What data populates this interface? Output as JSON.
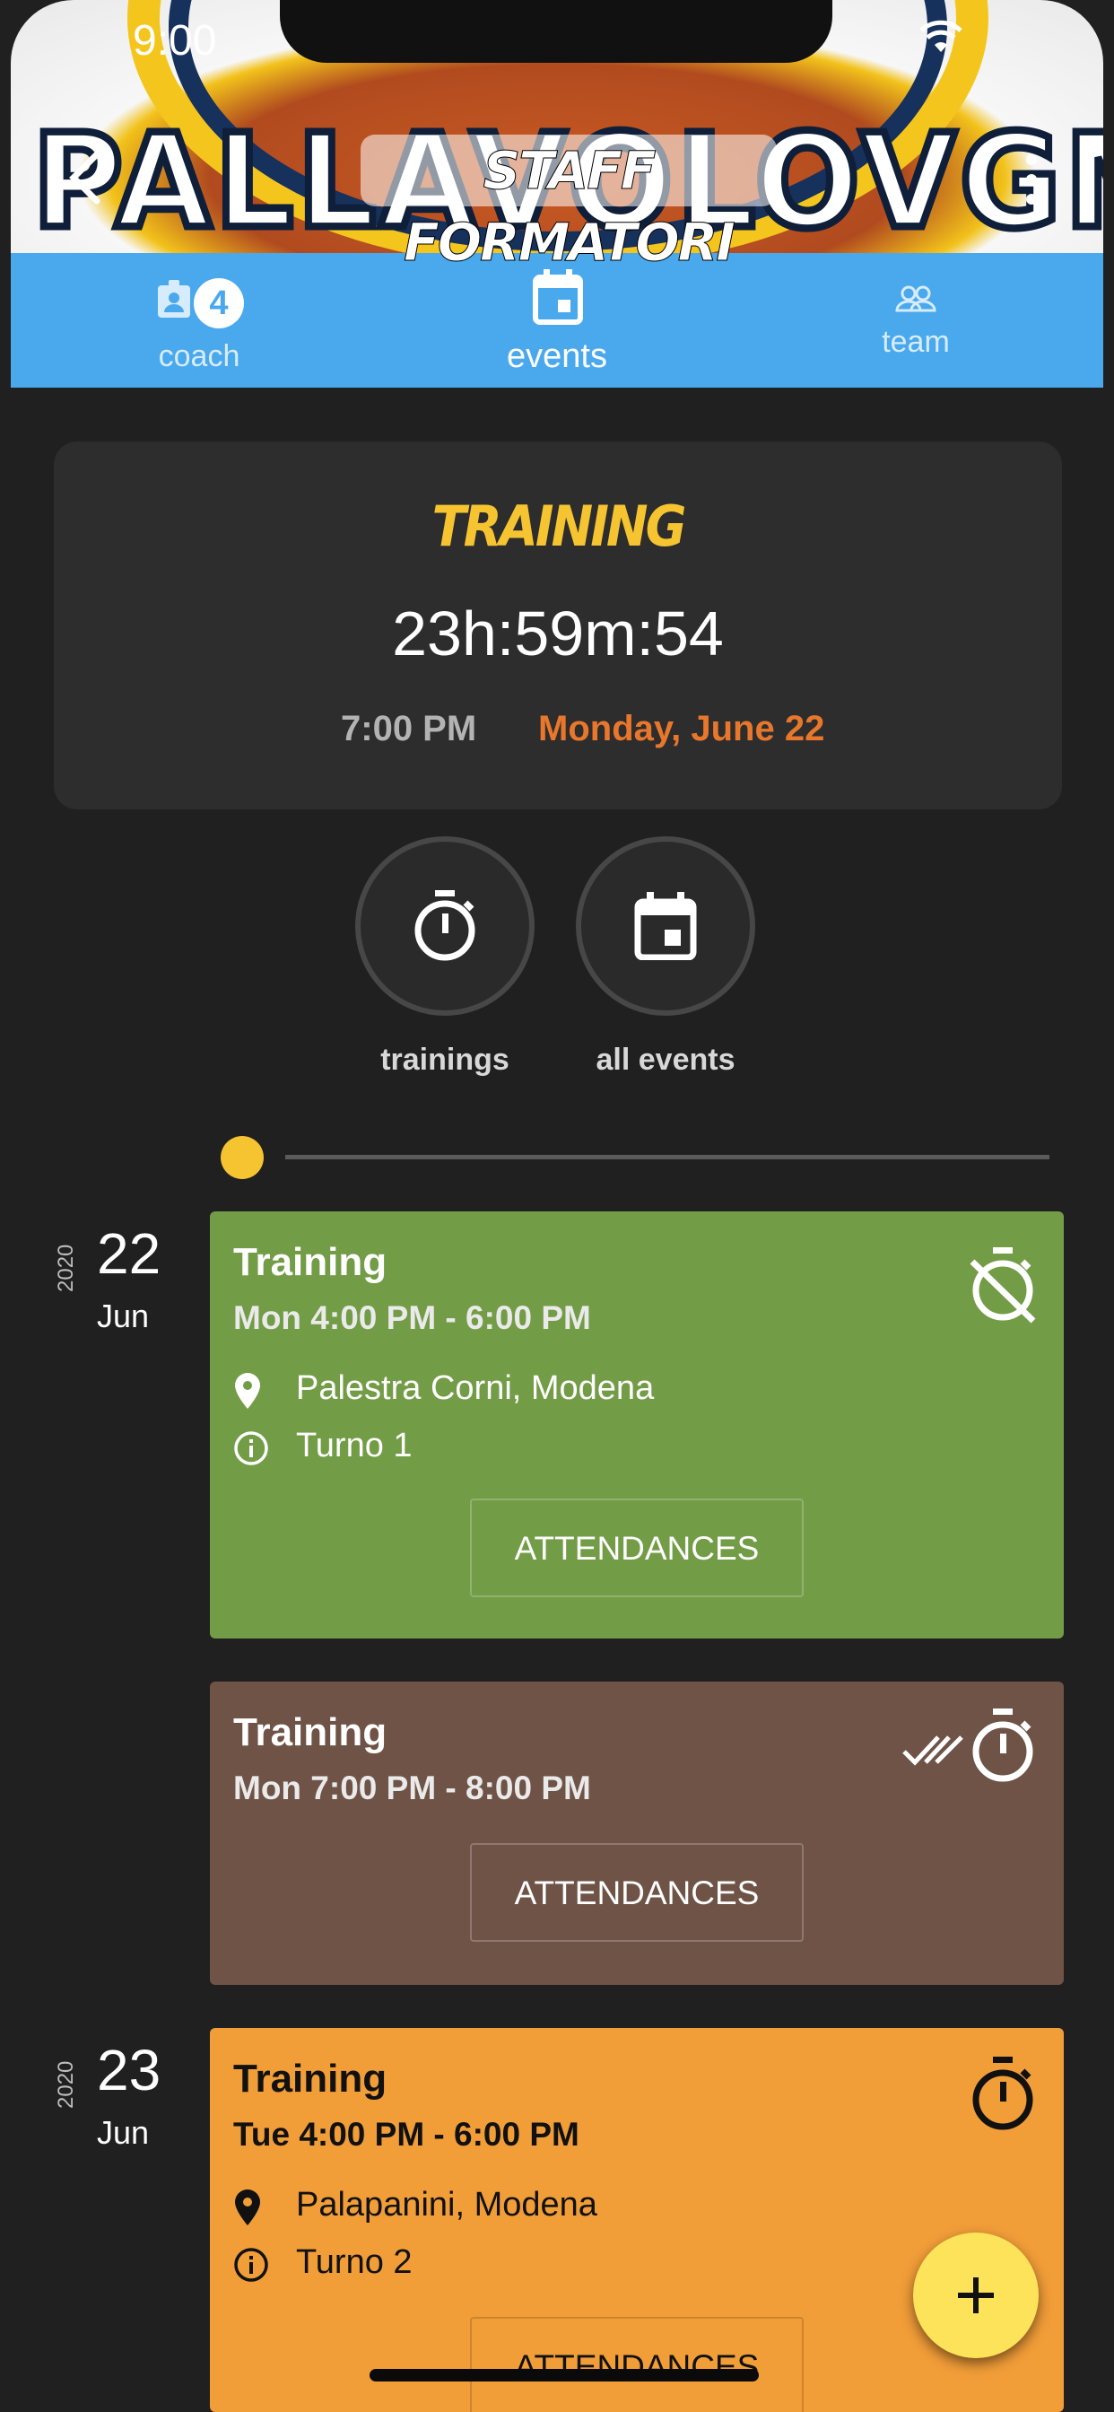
{
  "status_bar": {
    "time": "9:00"
  },
  "header": {
    "title": "STAFF FORMATORI",
    "brand_text": "PALLAVOLOVGM"
  },
  "tabs": {
    "coach": {
      "label": "coach",
      "badge": "4"
    },
    "events": {
      "label": "events"
    },
    "team": {
      "label": "team"
    }
  },
  "countdown": {
    "type": "TRAINING",
    "time_left": "23h:59m:54",
    "hour": "7:00 PM",
    "date": "Monday, June 22"
  },
  "quick_actions": {
    "trainings": "trainings",
    "all_events": "all events"
  },
  "days": [
    {
      "year": "2020",
      "day": "22",
      "month": "Jun"
    },
    {
      "year": "2020",
      "day": "23",
      "month": "Jun"
    }
  ],
  "events": [
    {
      "title": "Training",
      "time": "Mon 4:00 PM - 6:00 PM",
      "location": "Palestra Corni, Modena",
      "info": "Turno 1",
      "button": "ATTENDANCES",
      "color": "#739c47"
    },
    {
      "title": "Training",
      "time": "Mon 7:00 PM - 8:00 PM",
      "button": "ATTENDANCES",
      "color": "#6f5347"
    },
    {
      "title": "Training",
      "time": "Tue 4:00 PM - 6:00 PM",
      "location": "Palapanini, Modena",
      "info": "Turno 2",
      "button": "ATTENDANCES",
      "color": "#f19d38"
    }
  ],
  "colors": {
    "tab_bar": "#4aa9ec",
    "accent_yellow": "#f5c430",
    "accent_orange": "#e8772c",
    "fab": "#fde35a"
  }
}
